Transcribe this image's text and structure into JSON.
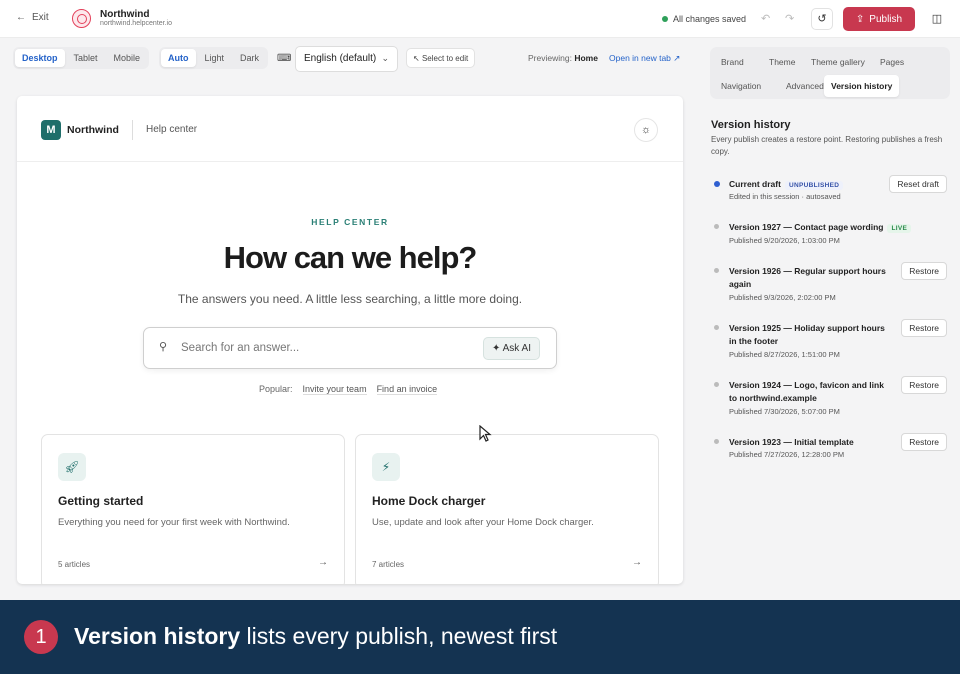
{
  "topbar": {
    "exit_label": "Exit",
    "site_name": "Northwind",
    "site_url": "northwind.helpcenter.io",
    "save_status": "All changes saved",
    "publish_label": "Publish",
    "icons": [
      "arrow-left-icon",
      "undo-icon",
      "redo-icon",
      "history-icon",
      "upload-icon",
      "layout-icon"
    ]
  },
  "toolbar": {
    "devices": [
      "Desktop",
      "Tablet",
      "Mobile"
    ],
    "active_device": "Desktop",
    "themes": [
      "Auto",
      "Light",
      "Dark"
    ],
    "active_theme": "Auto",
    "language": "English (default)",
    "select_to_edit": "Select to edit",
    "previewing_label": "Previewing:",
    "previewing_page": "Home",
    "open_new_tab": "Open in new tab"
  },
  "preview": {
    "logo_letter": "M",
    "brand": "Northwind",
    "nav_link": "Help center",
    "eyebrow": "HELP CENTER",
    "hero_title": "How can we help?",
    "subtitle": "The answers you need. A little less searching, a little more doing.",
    "search_placeholder": "Search for an answer...",
    "ask_ai": "Ask AI",
    "popular_label": "Popular:",
    "popular_links": [
      "Invite your team",
      "Find an invoice"
    ],
    "cards": [
      {
        "title": "Getting started",
        "desc": "Everything you need for your first week with Northwind.",
        "count": "5 articles",
        "icon": "rocket-icon"
      },
      {
        "title": "Home Dock charger",
        "desc": "Use, update and look after your Home Dock charger.",
        "count": "7 articles",
        "icon": "charger-icon"
      }
    ]
  },
  "side": {
    "tabs_row1": [
      "Brand",
      "Theme",
      "Theme gallery",
      "Pages"
    ],
    "tabs_row2": [
      "Navigation",
      "Advanced",
      "Version history"
    ],
    "active_tab": "Version history",
    "title": "Version history",
    "description": "Every publish creates a restore point. Restoring publishes a fresh copy.",
    "versions": [
      {
        "name": "Current draft",
        "badge": "UNPUBLISHED",
        "meta": "Edited in this session · autosaved",
        "action": "Reset draft"
      },
      {
        "name": "Version 1927 — Contact page wording",
        "badge": "LIVE",
        "meta": "Published 9/20/2026, 1:03:00 PM",
        "action": ""
      },
      {
        "name": "Version 1926 — Regular support hours again",
        "badge": "",
        "meta": "Published 9/3/2026, 2:02:00 PM",
        "action": "Restore"
      },
      {
        "name": "Version 1925 — Holiday support hours in the footer",
        "badge": "",
        "meta": "Published 8/27/2026, 1:51:00 PM",
        "action": "Restore"
      },
      {
        "name": "Version 1924 — Logo, favicon and link to northwind.example",
        "badge": "",
        "meta": "Published 7/30/2026, 5:07:00 PM",
        "action": "Restore"
      },
      {
        "name": "Version 1923 — Initial template",
        "badge": "",
        "meta": "Published 7/27/2026, 12:28:00 PM",
        "action": "Restore"
      }
    ]
  },
  "caption": {
    "step": "1",
    "bold": "Version history",
    "rest": " lists every publish, newest first"
  },
  "colors": {
    "accent": "#c8384f",
    "brand_teal": "#1f6e6a",
    "link_blue": "#2563c9",
    "caption_bg": "#143351"
  }
}
